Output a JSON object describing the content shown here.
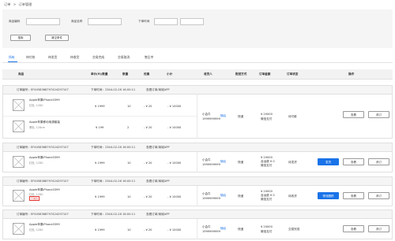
{
  "breadcrumb": {
    "root": "订单",
    "sep": ">",
    "current": "订单管理"
  },
  "filters": {
    "order_no_label": "商品编码",
    "product_name_label": "商品名称",
    "time_label": "下单时间",
    "search_button": "搜索",
    "clear_button": "清空条件"
  },
  "tabs": [
    "所有",
    "待付款",
    "待发货",
    "待收货",
    "交易完成",
    "交易取消",
    "售后中"
  ],
  "active_tab": 0,
  "columns": [
    "商品",
    "单价(¥)/数量",
    "数量",
    "优惠",
    "小计",
    "收货人",
    "配送方式",
    "订单金额",
    "订单状态",
    "操作"
  ],
  "orders": [
    {
      "order_no": "订单编号：EF4058368797424297107",
      "time": "下单时间：2344-02-26 16:00:11",
      "source": "查看订单/商城APP",
      "products": [
        {
          "name": "Apple苹果iPhone3399",
          "spec": "红色, 128G",
          "price": "¥ 1999",
          "qty": "10",
          "discount": "- ¥ 20",
          "subtotal": "- ¥ 10000"
        },
        {
          "name": "Apple苹果移动电源套装",
          "spec": "黑色, 128cm",
          "price": "¥ 199",
          "qty": "2",
          "discount": "- ¥ 20",
          "subtotal": "- ¥ 10000"
        }
      ],
      "receiver": "小会牛",
      "phone": "1999999999",
      "detail": "随后",
      "delivery": "快递",
      "amount": "¥ 20000",
      "pay": "微信支付",
      "status": "待付款",
      "primary_action": null,
      "actions": [
        "查看",
        "改订"
      ]
    },
    {
      "order_no": "订单编号：EF4058368797424297107",
      "time": "下单时间：2344-02-26 16:00:11",
      "source": "查看订单/商城APP",
      "products": [
        {
          "name": "Apple苹果iPhone3399",
          "spec": "红色, 128G",
          "price": "¥ 1999",
          "qty": "10",
          "discount": "- ¥ 20",
          "subtotal": "- ¥ 10000"
        }
      ],
      "receiver": "小会牛",
      "phone": "1999999999",
      "detail": "随后",
      "delivery": "快递",
      "amount": "¥ 20000",
      "amount_extra": "含运费 ¥ 0",
      "pay": "微信支付",
      "status": "待发货",
      "primary_action": "发货",
      "actions": [
        "查看",
        "改订"
      ]
    },
    {
      "order_no": "订单编号：EF4058368797424297107",
      "time": "下单时间：2344-02-26 16:00:11",
      "source": "查看订单/商城APP",
      "products": [
        {
          "name": "Apple苹果iPhone3399",
          "spec": "红色, 128G",
          "tag": "已发货",
          "price": "¥ 1999",
          "qty": "10",
          "discount": "- ¥ 20",
          "subtotal": "- ¥ 10000"
        }
      ],
      "receiver": "小会牛",
      "phone": "1999999999",
      "detail": "随后",
      "delivery": "快递",
      "amount": "¥ 20000",
      "amount_extra": "含运费 ¥ 0",
      "pay": "微信支付",
      "status": "待收货",
      "primary_action": "物流跟踪",
      "actions": [
        "查看",
        "改订"
      ]
    },
    {
      "order_no": "订单编号：EF4058368797424297107",
      "time": "下单时间：2344-02-26 16:00:11",
      "source": "查看订单/商城APP",
      "products": [
        {
          "name": "Apple苹果iPhone3399",
          "spec": "红色, 128G",
          "price": "¥ 1999",
          "qty": "10",
          "discount": "- ¥ 20",
          "subtotal": "- ¥ 10000"
        }
      ],
      "receiver": "小会牛",
      "phone": "1999999999",
      "detail": "随后",
      "delivery": "快递",
      "amount": "¥ 20000",
      "pay": "微信支付",
      "status": "交易完成",
      "primary_action": null,
      "actions": [
        "查看",
        "改订"
      ]
    }
  ],
  "colors": {
    "accent": "#1a73e8",
    "tag_red": "#e53935"
  }
}
